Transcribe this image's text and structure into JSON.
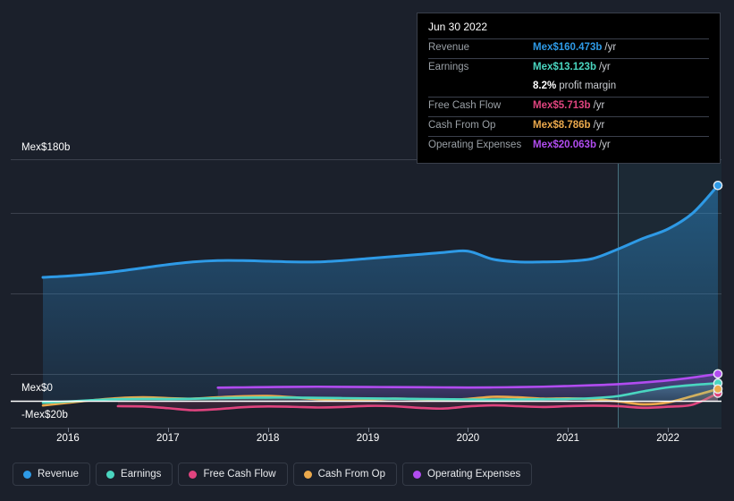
{
  "chart_data": {
    "type": "area",
    "title": "",
    "xlabel": "",
    "ylabel": "",
    "currency_prefix": "Mex$",
    "ylim": [
      -20,
      180
    ],
    "y_ticks": [
      180,
      0,
      -20
    ],
    "y_tick_labels": [
      "Mex$180b",
      "Mex$0",
      "-Mex$20b"
    ],
    "grid": true,
    "legend_position": "bottom",
    "x_ticks": [
      2016,
      2017,
      2018,
      2019,
      2020,
      2021,
      2022
    ],
    "x_tick_labels": [
      "2016",
      "2017",
      "2018",
      "2019",
      "2020",
      "2021",
      "2022"
    ],
    "forecast_start": 2021.5,
    "series": [
      {
        "name": "Revenue",
        "color": "#2e9ae6",
        "x": [
          2015.75,
          2016.0,
          2016.25,
          2016.5,
          2016.75,
          2017.0,
          2017.25,
          2017.5,
          2017.75,
          2018.0,
          2018.25,
          2018.5,
          2018.75,
          2019.0,
          2019.25,
          2019.5,
          2019.75,
          2020.0,
          2020.25,
          2020.5,
          2020.75,
          2021.0,
          2021.25,
          2021.5,
          2021.75,
          2022.0,
          2022.25,
          2022.5
        ],
        "values": [
          92.0,
          93.0,
          94.5,
          96.5,
          99.0,
          101.5,
          103.5,
          104.5,
          104.5,
          104.0,
          103.5,
          103.5,
          104.5,
          106.0,
          107.5,
          109.0,
          110.5,
          111.5,
          105.5,
          103.5,
          103.5,
          104.0,
          106.0,
          113.0,
          121.0,
          128.0,
          140.0,
          160.473
        ]
      },
      {
        "name": "Earnings",
        "color": "#4ad6c0",
        "x": [
          2015.75,
          2016.0,
          2016.25,
          2016.5,
          2016.75,
          2017.0,
          2017.25,
          2017.5,
          2017.75,
          2018.0,
          2018.25,
          2018.5,
          2018.75,
          2019.0,
          2019.25,
          2019.5,
          2019.75,
          2020.0,
          2020.25,
          2020.5,
          2020.75,
          2021.0,
          2021.25,
          2021.5,
          2021.75,
          2022.0,
          2022.25,
          2022.5
        ],
        "values": [
          -1.5,
          -0.5,
          0.5,
          1.2,
          1.4,
          1.3,
          1.5,
          2.0,
          2.3,
          2.4,
          2.4,
          2.2,
          2.0,
          1.8,
          1.6,
          1.4,
          1.2,
          1.0,
          0.9,
          1.0,
          1.2,
          1.4,
          2.0,
          3.5,
          7.0,
          10.0,
          11.8,
          13.123
        ]
      },
      {
        "name": "Free Cash Flow",
        "color": "#e0447f",
        "x": [
          2016.5,
          2016.75,
          2017.0,
          2017.25,
          2017.5,
          2017.75,
          2018.0,
          2018.25,
          2018.5,
          2018.75,
          2019.0,
          2019.25,
          2019.5,
          2019.75,
          2020.0,
          2020.25,
          2020.5,
          2020.75,
          2021.0,
          2021.25,
          2021.5,
          2021.75,
          2022.0,
          2022.25,
          2022.5
        ],
        "values": [
          -4.0,
          -4.2,
          -5.5,
          -7.0,
          -6.2,
          -4.8,
          -4.2,
          -4.5,
          -5.0,
          -4.6,
          -3.8,
          -4.0,
          -5.2,
          -5.8,
          -4.2,
          -3.4,
          -4.0,
          -4.6,
          -4.0,
          -3.6,
          -4.0,
          -5.2,
          -4.4,
          -2.8,
          5.713
        ]
      },
      {
        "name": "Cash From Op",
        "color": "#eba94c",
        "x": [
          2015.75,
          2016.0,
          2016.25,
          2016.5,
          2016.75,
          2017.0,
          2017.25,
          2017.5,
          2017.75,
          2018.0,
          2018.25,
          2018.5,
          2018.75,
          2019.0,
          2019.25,
          2019.5,
          2019.75,
          2020.0,
          2020.25,
          2020.5,
          2020.75,
          2021.0,
          2021.25,
          2021.5,
          2021.75,
          2022.0,
          2022.25,
          2022.5
        ],
        "values": [
          -3.5,
          -1.5,
          0.5,
          2.0,
          2.6,
          2.0,
          1.6,
          2.6,
          3.4,
          3.6,
          2.6,
          1.2,
          0.2,
          0.6,
          1.6,
          1.2,
          0.4,
          1.4,
          3.0,
          2.6,
          1.6,
          1.8,
          1.2,
          -0.4,
          -2.6,
          -1.2,
          3.6,
          8.786
        ]
      },
      {
        "name": "Operating Expenses",
        "color": "#b14cf0",
        "x": [
          2017.5,
          2017.75,
          2018.0,
          2018.25,
          2018.5,
          2018.75,
          2019.0,
          2019.25,
          2019.5,
          2019.75,
          2020.0,
          2020.25,
          2020.5,
          2020.75,
          2021.0,
          2021.25,
          2021.5,
          2021.75,
          2022.0,
          2022.25,
          2022.5
        ],
        "values": [
          9.8,
          10.0,
          10.2,
          10.4,
          10.5,
          10.4,
          10.3,
          10.2,
          10.1,
          10.0,
          9.9,
          10.0,
          10.2,
          10.5,
          11.0,
          11.6,
          12.4,
          13.6,
          15.2,
          17.4,
          20.063
        ]
      }
    ]
  },
  "tooltip": {
    "date": "Jun 30 2022",
    "rows": [
      {
        "key": "Revenue",
        "value": "Mex$160.473b",
        "suffix": "/yr",
        "color": "#2e9ae6"
      },
      {
        "key": "Earnings",
        "value": "Mex$13.123b",
        "suffix": "/yr",
        "color": "#4ad6c0"
      },
      {
        "key": "",
        "value": "8.2%",
        "suffix": "profit margin",
        "color": "#ffffff",
        "is_margin": true
      },
      {
        "key": "Free Cash Flow",
        "value": "Mex$5.713b",
        "suffix": "/yr",
        "color": "#e0447f"
      },
      {
        "key": "Cash From Op",
        "value": "Mex$8.786b",
        "suffix": "/yr",
        "color": "#eba94c"
      },
      {
        "key": "Operating Expenses",
        "value": "Mex$20.063b",
        "suffix": "/yr",
        "color": "#b14cf0"
      }
    ]
  },
  "legend": {
    "items": [
      {
        "label": "Revenue",
        "color": "#2e9ae6"
      },
      {
        "label": "Earnings",
        "color": "#4ad6c0"
      },
      {
        "label": "Free Cash Flow",
        "color": "#e0447f"
      },
      {
        "label": "Cash From Op",
        "color": "#eba94c"
      },
      {
        "label": "Operating Expenses",
        "color": "#b14cf0"
      }
    ]
  },
  "axis": {
    "y_top_label": "Mex$180b",
    "y_zero_label": "Mex$0",
    "y_bottom_label": "-Mex$20b"
  }
}
